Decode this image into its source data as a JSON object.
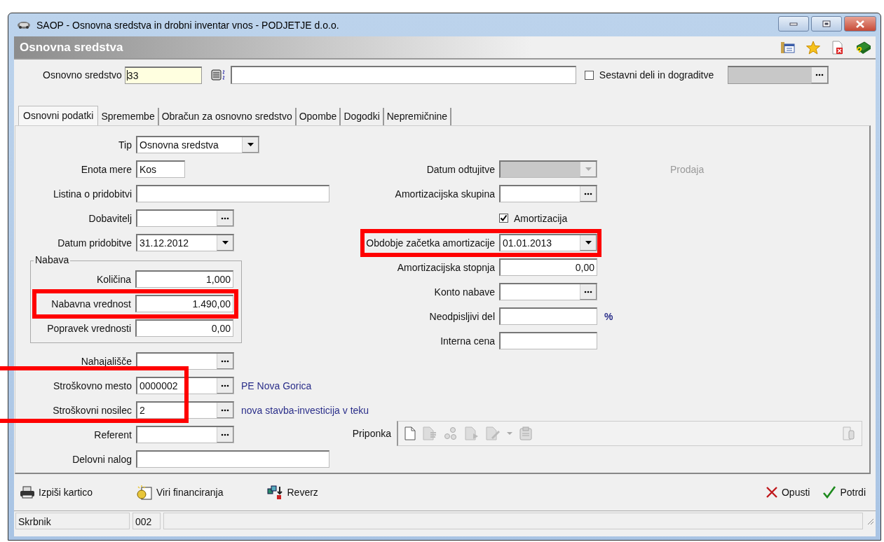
{
  "window": {
    "title": "SAOP -  Osnovna sredstva in drobni inventar vnos - PODJETJE d.o.o."
  },
  "header": {
    "title": "Osnovna sredstva"
  },
  "asset": {
    "label": "Osnovno sredstvo",
    "value": "33"
  },
  "components": {
    "label": "Sestavni deli in dograditve",
    "checked": false
  },
  "tabs": [
    {
      "label": "Osnovni podatki",
      "selected": true
    },
    {
      "label": "Spremembe",
      "selected": false
    },
    {
      "label": "Obračun za osnovno sredstvo",
      "selected": false
    },
    {
      "label": "Opombe",
      "selected": false
    },
    {
      "label": "Dogodki",
      "selected": false
    },
    {
      "label": "Nepremičnine",
      "selected": false
    }
  ],
  "left_fields": [
    {
      "kind": "combo",
      "label": "Tip",
      "value": "Osnovna sredstva"
    },
    {
      "kind": "text",
      "label": "Enota mere",
      "value": "Kos"
    },
    {
      "kind": "text",
      "label": "Listina o pridobitvi"
    },
    {
      "kind": "lookup",
      "label": "Dobavitelj"
    },
    {
      "kind": "combo",
      "label": "Datum pridobitve",
      "value": "31.12.2012"
    },
    {
      "kind": "group",
      "label": "Nabava",
      "children": [
        {
          "kind": "number",
          "label": "Količina",
          "value": "1,000"
        },
        {
          "kind": "number",
          "label": "Nabavna vrednost",
          "value": "1.490,00"
        },
        {
          "kind": "number",
          "label": "Popravek vrednosti",
          "value": "0,00"
        }
      ]
    },
    {
      "kind": "lookup",
      "label": "Nahajališče"
    },
    {
      "kind": "lookup",
      "label": "Stroškovno mesto",
      "value": "0000002",
      "note": "PE Nova Gorica"
    },
    {
      "kind": "lookup",
      "label": "Stroškovni nosilec",
      "value": "2",
      "note": "nova stavba-investicija v teku"
    },
    {
      "kind": "lookup",
      "label": "Referent"
    },
    {
      "kind": "text",
      "label": "Delovni nalog"
    }
  ],
  "right_fields": [
    {
      "kind": "combo",
      "label": "Datum odtujitve",
      "disabled": true,
      "aside": "Prodaja"
    },
    {
      "kind": "lookup",
      "label": "Amortizacijska skupina"
    },
    {
      "kind": "checkbox",
      "label": "Amortizacija",
      "checked": true
    },
    {
      "kind": "combo",
      "label": "Obdobje začetka amortizacije",
      "value": "01.01.2013"
    },
    {
      "kind": "number",
      "label": "Amortizacijska stopnja",
      "value": "0,00"
    },
    {
      "kind": "lookup",
      "label": "Konto nabave"
    },
    {
      "kind": "text",
      "label": "Neodpisljivi del",
      "suffix": "%"
    },
    {
      "kind": "text",
      "label": "Interna cena"
    }
  ],
  "attachment": {
    "label": "Priponka"
  },
  "actions": [
    {
      "kind": "print",
      "label": "Izpiši kartico"
    },
    {
      "kind": "funding",
      "label": "Viri financiranja"
    },
    {
      "kind": "reverse",
      "label": "Reverz"
    }
  ],
  "dialog_buttons": [
    {
      "kind": "cancel",
      "label": "Opusti"
    },
    {
      "kind": "confirm",
      "label": "Potrdi"
    }
  ],
  "status_bar": [
    "Skrbnik",
    "002"
  ]
}
